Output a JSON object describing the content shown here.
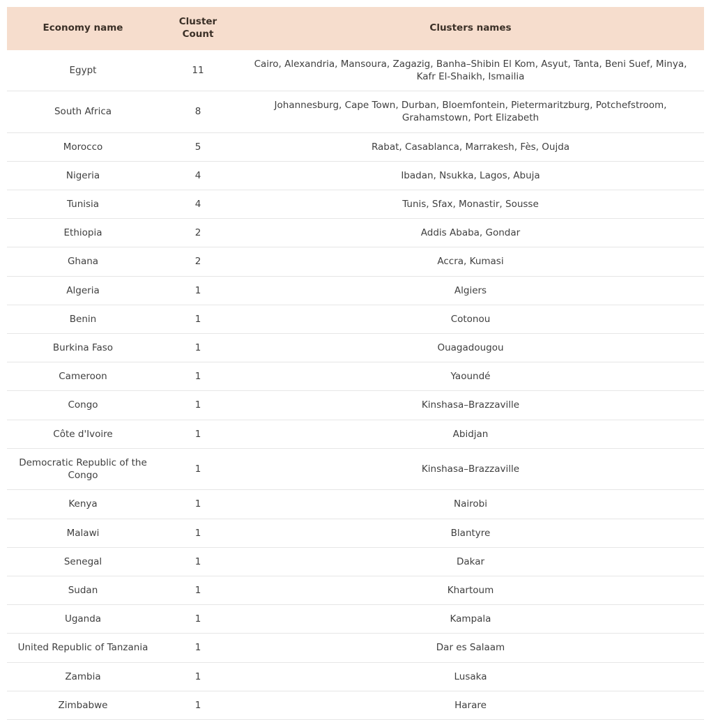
{
  "table": {
    "columns": [
      {
        "id": "economy_name",
        "label": "Economy name"
      },
      {
        "id": "cluster_count",
        "label": "Cluster\nCount"
      },
      {
        "id": "clusters_names",
        "label": "Clusters names"
      }
    ],
    "header_label_economy": "Economy name",
    "header_label_count_line1": "Cluster",
    "header_label_count_line2": "Count",
    "header_label_clusters": "Clusters names",
    "colors": {
      "header_background": "#f6ddcd",
      "header_text": "#3b3027",
      "body_text": "#3f3f3f",
      "row_divider": "#e6e6e6",
      "page_background": "#ffffff"
    },
    "rows": [
      {
        "economy_name": "Egypt",
        "cluster_count": "11",
        "clusters_names": "Cairo, Alexandria, Mansoura, Zagazig, Banha–Shibin El Kom, Asyut, Tanta, Beni Suef, Minya, Kafr El-Shaikh, Ismailia"
      },
      {
        "economy_name": "South Africa",
        "cluster_count": "8",
        "clusters_names": "Johannesburg, Cape Town, Durban, Bloemfontein, Pietermaritzburg, Potchefstroom, Grahamstown, Port Elizabeth"
      },
      {
        "economy_name": "Morocco",
        "cluster_count": "5",
        "clusters_names": "Rabat, Casablanca, Marrakesh, Fès, Oujda"
      },
      {
        "economy_name": "Nigeria",
        "cluster_count": "4",
        "clusters_names": "Ibadan, Nsukka, Lagos, Abuja"
      },
      {
        "economy_name": "Tunisia",
        "cluster_count": "4",
        "clusters_names": "Tunis, Sfax, Monastir, Sousse"
      },
      {
        "economy_name": "Ethiopia",
        "cluster_count": "2",
        "clusters_names": "Addis Ababa, Gondar"
      },
      {
        "economy_name": "Ghana",
        "cluster_count": "2",
        "clusters_names": "Accra, Kumasi"
      },
      {
        "economy_name": "Algeria",
        "cluster_count": "1",
        "clusters_names": "Algiers"
      },
      {
        "economy_name": "Benin",
        "cluster_count": "1",
        "clusters_names": "Cotonou"
      },
      {
        "economy_name": "Burkina Faso",
        "cluster_count": "1",
        "clusters_names": "Ouagadougou"
      },
      {
        "economy_name": "Cameroon",
        "cluster_count": "1",
        "clusters_names": "Yaoundé"
      },
      {
        "economy_name": "Congo",
        "cluster_count": "1",
        "clusters_names": "Kinshasa–Brazzaville"
      },
      {
        "economy_name": "Côte d'Ivoire",
        "cluster_count": "1",
        "clusters_names": "Abidjan"
      },
      {
        "economy_name": "Democratic Republic of the Congo",
        "cluster_count": "1",
        "clusters_names": "Kinshasa–Brazzaville"
      },
      {
        "economy_name": "Kenya",
        "cluster_count": "1",
        "clusters_names": "Nairobi"
      },
      {
        "economy_name": "Malawi",
        "cluster_count": "1",
        "clusters_names": "Blantyre"
      },
      {
        "economy_name": "Senegal",
        "cluster_count": "1",
        "clusters_names": "Dakar"
      },
      {
        "economy_name": "Sudan",
        "cluster_count": "1",
        "clusters_names": "Khartoum"
      },
      {
        "economy_name": "Uganda",
        "cluster_count": "1",
        "clusters_names": "Kampala"
      },
      {
        "economy_name": "United Republic of Tanzania",
        "cluster_count": "1",
        "clusters_names": "Dar es Salaam"
      },
      {
        "economy_name": "Zambia",
        "cluster_count": "1",
        "clusters_names": "Lusaka"
      },
      {
        "economy_name": "Zimbabwe",
        "cluster_count": "1",
        "clusters_names": "Harare"
      }
    ]
  }
}
